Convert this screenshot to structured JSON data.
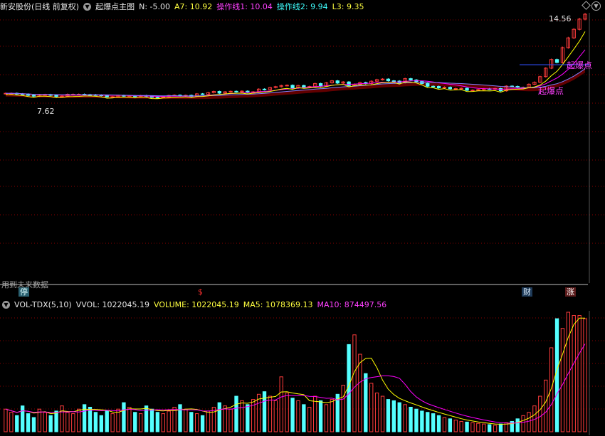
{
  "main_header": {
    "stock": "新安股份(日线 前复权)",
    "indicator": "起爆点主图",
    "n": "N: -5.00",
    "a7": "A7: 10.92",
    "op1": "操作线1: 10.04",
    "op2": "操作线2: 9.94",
    "l3": "L3: 9.35"
  },
  "price": {
    "high_label": "14.56",
    "low_label": "7.62",
    "signal_label": "起爆点",
    "signal_label2": "起爆点",
    "future_note": "用到未来数据"
  },
  "strip": {
    "left_mark": "停",
    "mid_mark": "$",
    "finance_mark": "财",
    "up_mark": "涨"
  },
  "vol_header": {
    "name": "VOL-TDX(5,10)",
    "vvol": "VVOL: 1022045.19",
    "volume": "VOLUME: 1022045.19",
    "ma5": "MA5: 1078369.13",
    "ma10": "MA10: 874497.56"
  },
  "colors": {
    "up": "#ff3c3c",
    "down": "#54ffff",
    "ma_white": "#ffffff",
    "ma_yellow": "#ffff00",
    "ma_magenta": "#ff00ff",
    "grid": "#8b0000"
  },
  "chart_data": {
    "type": "bar",
    "price_series": [
      9.05,
      9.05,
      9.01,
      8.99,
      8.91,
      8.85,
      8.95,
      8.96,
      8.91,
      8.83,
      8.85,
      8.98,
      8.98,
      8.98,
      8.96,
      8.95,
      8.93,
      8.89,
      8.8,
      8.81,
      8.9,
      8.86,
      8.88,
      8.82,
      8.89,
      8.85,
      8.77,
      8.76,
      8.81,
      8.9,
      8.92,
      8.87,
      8.91,
      8.83,
      9.01,
      8.98,
      9.09,
      9.18,
      9.06,
      9.15,
      9.19,
      9.15,
      9.2,
      9.1,
      9.15,
      9.34,
      9.3,
      9.45,
      9.51,
      9.59,
      9.61,
      9.42,
      9.59,
      9.49,
      9.52,
      9.73,
      9.54,
      9.78,
      9.92,
      9.76,
      9.84,
      9.59,
      9.68,
      9.8,
      9.73,
      9.89,
      10.0,
      10.04,
      9.92,
      9.9,
      9.79,
      10.07,
      9.98,
      9.87,
      9.73,
      9.54,
      9.53,
      9.42,
      9.47,
      9.36,
      9.38,
      9.4,
      9.26,
      9.27,
      9.31,
      9.36,
      9.33,
      9.38,
      9.22,
      9.55,
      9.53,
      9.46,
      9.46,
      9.68,
      9.82,
      10.21,
      10.8,
      11.4,
      11.2,
      12.23,
      12.91,
      13.51,
      14.22,
      14.56
    ],
    "volume_series": [
      35,
      30,
      25,
      40,
      28,
      22,
      35,
      30,
      25,
      32,
      40,
      30,
      28,
      35,
      42,
      38,
      30,
      25,
      32,
      28,
      35,
      45,
      38,
      30,
      28,
      40,
      35,
      30,
      28,
      32,
      38,
      42,
      35,
      30,
      28,
      25,
      32,
      38,
      45,
      40,
      35,
      55,
      48,
      42,
      50,
      58,
      62,
      55,
      48,
      85,
      60,
      52,
      48,
      42,
      38,
      55,
      48,
      42,
      50,
      58,
      72,
      135,
      150,
      120,
      90,
      75,
      60,
      55,
      50,
      48,
      45,
      42,
      38,
      35,
      32,
      30,
      28,
      25,
      22,
      20,
      18,
      16,
      15,
      14,
      13,
      12,
      11,
      10,
      12,
      14,
      16,
      20,
      25,
      30,
      40,
      55,
      80,
      130,
      175,
      160,
      185,
      180,
      180,
      175
    ],
    "price_high": 14.56,
    "price_low": 7.62
  }
}
